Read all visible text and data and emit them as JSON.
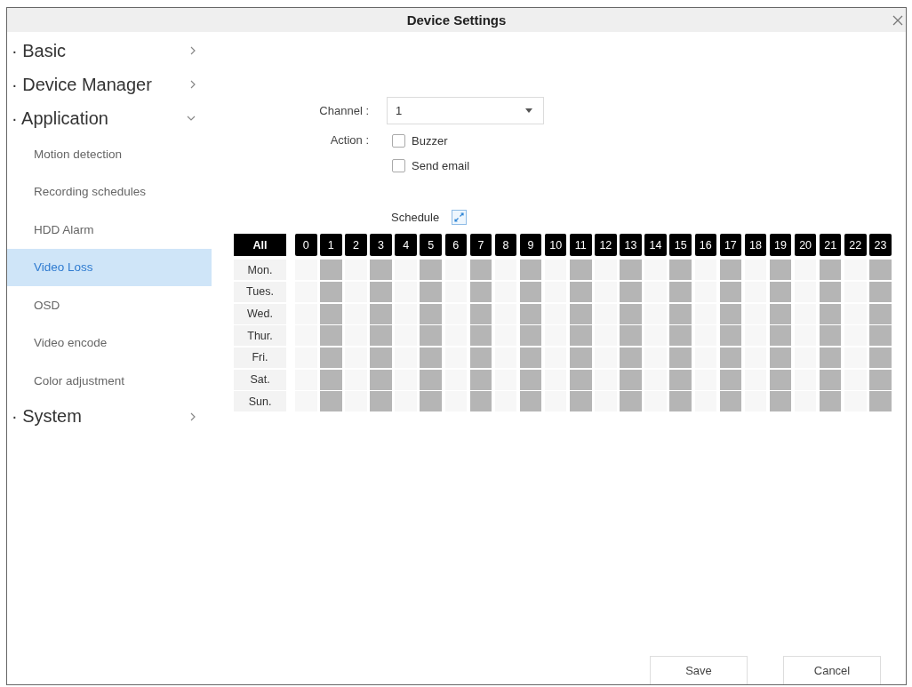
{
  "window": {
    "title": "Device Settings"
  },
  "sidebar": {
    "items": [
      {
        "label": "· Basic",
        "expanded": false
      },
      {
        "label": "· Device Manager",
        "expanded": false
      },
      {
        "label": "· Application",
        "expanded": true,
        "children": [
          {
            "label": "Motion detection",
            "selected": false
          },
          {
            "label": "Recording schedules",
            "selected": false
          },
          {
            "label": "HDD Alarm",
            "selected": false
          },
          {
            "label": "Video Loss",
            "selected": true
          },
          {
            "label": "OSD",
            "selected": false
          },
          {
            "label": "Video encode",
            "selected": false
          },
          {
            "label": "Color adjustment",
            "selected": false
          }
        ]
      },
      {
        "label": "· System",
        "expanded": false
      }
    ]
  },
  "form": {
    "channel": {
      "label": "Channel :",
      "value": "1"
    },
    "action": {
      "label": "Action :",
      "options": [
        {
          "label": "Buzzer",
          "checked": false
        },
        {
          "label": "Send email",
          "checked": false
        }
      ]
    },
    "schedule": {
      "label": "Schedule"
    }
  },
  "schedule_grid": {
    "all_label": "All",
    "hours": [
      "0",
      "1",
      "2",
      "3",
      "4",
      "5",
      "6",
      "7",
      "8",
      "9",
      "10",
      "11",
      "12",
      "13",
      "14",
      "15",
      "16",
      "17",
      "18",
      "19",
      "20",
      "21",
      "22",
      "23"
    ],
    "days": [
      {
        "label": "Mon.",
        "slots": [
          {
            "selected": false
          },
          {
            "selected": true
          },
          {
            "selected": false
          },
          {
            "selected": true
          },
          {
            "selected": false
          },
          {
            "selected": true
          },
          {
            "selected": false
          },
          {
            "selected": true
          },
          {
            "selected": false
          },
          {
            "selected": true
          },
          {
            "selected": false
          },
          {
            "selected": true
          },
          {
            "selected": false
          },
          {
            "selected": true
          },
          {
            "selected": false
          },
          {
            "selected": true
          },
          {
            "selected": false
          },
          {
            "selected": true
          },
          {
            "selected": false
          },
          {
            "selected": true
          },
          {
            "selected": false
          },
          {
            "selected": true
          },
          {
            "selected": false
          },
          {
            "selected": true
          }
        ]
      },
      {
        "label": "Tues.",
        "slots": [
          {
            "selected": false
          },
          {
            "selected": true
          },
          {
            "selected": false
          },
          {
            "selected": true
          },
          {
            "selected": false
          },
          {
            "selected": true
          },
          {
            "selected": false
          },
          {
            "selected": true
          },
          {
            "selected": false
          },
          {
            "selected": true
          },
          {
            "selected": false
          },
          {
            "selected": true
          },
          {
            "selected": false
          },
          {
            "selected": true
          },
          {
            "selected": false
          },
          {
            "selected": true
          },
          {
            "selected": false
          },
          {
            "selected": true
          },
          {
            "selected": false
          },
          {
            "selected": true
          },
          {
            "selected": false
          },
          {
            "selected": true
          },
          {
            "selected": false
          },
          {
            "selected": true
          }
        ]
      },
      {
        "label": "Wed.",
        "slots": [
          {
            "selected": false
          },
          {
            "selected": true
          },
          {
            "selected": false
          },
          {
            "selected": true
          },
          {
            "selected": false
          },
          {
            "selected": true
          },
          {
            "selected": false
          },
          {
            "selected": true
          },
          {
            "selected": false
          },
          {
            "selected": true
          },
          {
            "selected": false
          },
          {
            "selected": true
          },
          {
            "selected": false
          },
          {
            "selected": true
          },
          {
            "selected": false
          },
          {
            "selected": true
          },
          {
            "selected": false
          },
          {
            "selected": true
          },
          {
            "selected": false
          },
          {
            "selected": true
          },
          {
            "selected": false
          },
          {
            "selected": true
          },
          {
            "selected": false
          },
          {
            "selected": true
          }
        ]
      },
      {
        "label": "Thur.",
        "slots": [
          {
            "selected": false
          },
          {
            "selected": true
          },
          {
            "selected": false
          },
          {
            "selected": true
          },
          {
            "selected": false
          },
          {
            "selected": true
          },
          {
            "selected": false
          },
          {
            "selected": true
          },
          {
            "selected": false
          },
          {
            "selected": true
          },
          {
            "selected": false
          },
          {
            "selected": true
          },
          {
            "selected": false
          },
          {
            "selected": true
          },
          {
            "selected": false
          },
          {
            "selected": true
          },
          {
            "selected": false
          },
          {
            "selected": true
          },
          {
            "selected": false
          },
          {
            "selected": true
          },
          {
            "selected": false
          },
          {
            "selected": true
          },
          {
            "selected": false
          },
          {
            "selected": true
          }
        ]
      },
      {
        "label": "Fri.",
        "slots": [
          {
            "selected": false
          },
          {
            "selected": true
          },
          {
            "selected": false
          },
          {
            "selected": true
          },
          {
            "selected": false
          },
          {
            "selected": true
          },
          {
            "selected": false
          },
          {
            "selected": true
          },
          {
            "selected": false
          },
          {
            "selected": true
          },
          {
            "selected": false
          },
          {
            "selected": true
          },
          {
            "selected": false
          },
          {
            "selected": true
          },
          {
            "selected": false
          },
          {
            "selected": true
          },
          {
            "selected": false
          },
          {
            "selected": true
          },
          {
            "selected": false
          },
          {
            "selected": true
          },
          {
            "selected": false
          },
          {
            "selected": true
          },
          {
            "selected": false
          },
          {
            "selected": true
          }
        ]
      },
      {
        "label": "Sat.",
        "slots": [
          {
            "selected": false
          },
          {
            "selected": true
          },
          {
            "selected": false
          },
          {
            "selected": true
          },
          {
            "selected": false
          },
          {
            "selected": true
          },
          {
            "selected": false
          },
          {
            "selected": true
          },
          {
            "selected": false
          },
          {
            "selected": true
          },
          {
            "selected": false
          },
          {
            "selected": true
          },
          {
            "selected": false
          },
          {
            "selected": true
          },
          {
            "selected": false
          },
          {
            "selected": true
          },
          {
            "selected": false
          },
          {
            "selected": true
          },
          {
            "selected": false
          },
          {
            "selected": true
          },
          {
            "selected": false
          },
          {
            "selected": true
          },
          {
            "selected": false
          },
          {
            "selected": true
          }
        ]
      },
      {
        "label": "Sun.",
        "slots": [
          {
            "selected": false
          },
          {
            "selected": true
          },
          {
            "selected": false
          },
          {
            "selected": true
          },
          {
            "selected": false
          },
          {
            "selected": true
          },
          {
            "selected": false
          },
          {
            "selected": true
          },
          {
            "selected": false
          },
          {
            "selected": true
          },
          {
            "selected": false
          },
          {
            "selected": true
          },
          {
            "selected": false
          },
          {
            "selected": true
          },
          {
            "selected": false
          },
          {
            "selected": true
          },
          {
            "selected": false
          },
          {
            "selected": true
          },
          {
            "selected": false
          },
          {
            "selected": true
          },
          {
            "selected": false
          },
          {
            "selected": true
          },
          {
            "selected": false
          },
          {
            "selected": true
          }
        ]
      }
    ]
  },
  "buttons": [
    {
      "label": "Save"
    },
    {
      "label": "Cancel"
    }
  ]
}
